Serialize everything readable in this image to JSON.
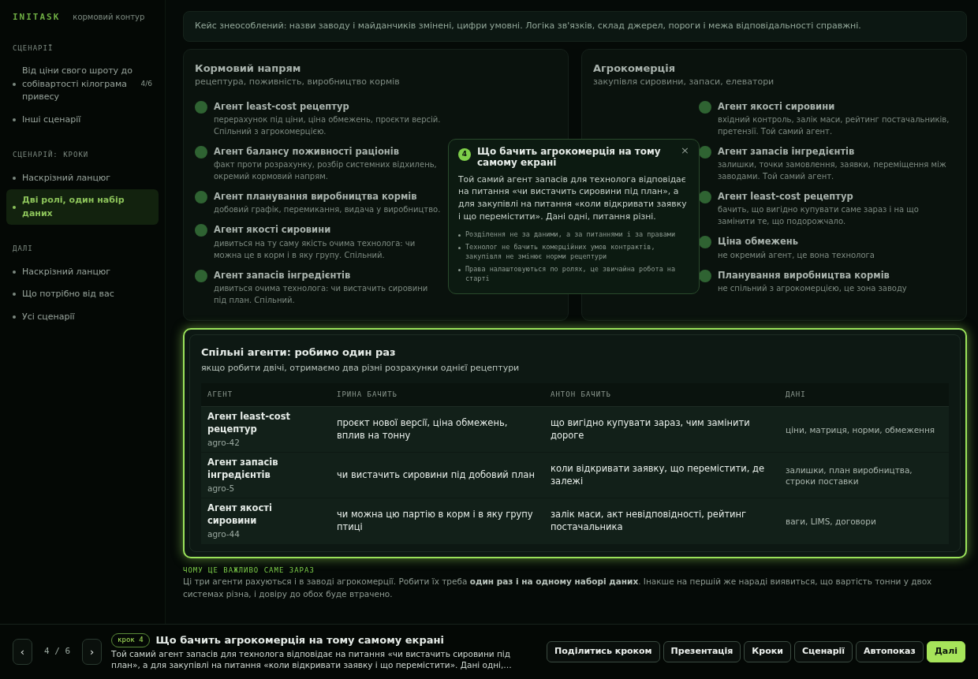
{
  "sidebar": {
    "logo": "INITASK",
    "subtitle": "кормовий контур",
    "sections": [
      {
        "heading": "СЦЕНАРІЇ",
        "items": [
          {
            "label": "Від ціни свого шроту до собівартості кілограма привесу",
            "count": "4/6",
            "selected": false
          },
          {
            "label": "Інші сценарії",
            "selected": false
          }
        ]
      },
      {
        "heading": "СЦЕНАРІЙ: КРОКИ",
        "items": [
          {
            "label": "Наскрізний ланцюг",
            "selected": false
          },
          {
            "label": "Дві ролі, один набір даних",
            "selected": true
          }
        ]
      },
      {
        "heading": "ДАЛІ",
        "items": [
          {
            "label": "Наскрізний ланцюг",
            "selected": false
          },
          {
            "label": "Що потрібно від вас",
            "selected": false
          },
          {
            "label": "Усі сценарії",
            "selected": false
          }
        ]
      }
    ]
  },
  "notice": "Кейс знеособлений: назви заводу і майданчиків змінені, цифри умовні. Логіка зв'язків, склад джерел, пороги і межа відповідальності справжні.",
  "directions": [
    {
      "title": "Кормовий напрям",
      "subtitle": "рецептура, поживність, виробництво кормів",
      "agents": [
        {
          "name": "Агент least-cost рецептур",
          "text": "перерахунок під ціни, ціна обмежень, проєкти версій. Спільний з агрокомерцією."
        },
        {
          "name": "Агент балансу поживності раціонів",
          "text": "факт проти розрахунку, розбір системних відхилень, окремий кормовий напрям."
        },
        {
          "name": "Агент планування виробництва кормів",
          "text": "добовий графік, перемикання, видача у виробництво."
        },
        {
          "name": "Агент якості сировини",
          "text": "дивиться на ту саму якість очима технолога: чи можна це в корм і в яку групу. Спільний."
        },
        {
          "name": "Агент запасів інгредієнтів",
          "text": "дивиться очима технолога: чи вистачить сировини під план. Спільний."
        }
      ]
    },
    {
      "title": "Агрокомерція",
      "subtitle": "закупівля сировини, запаси, елеватори",
      "agents": [
        {
          "name": "Агент якості сировини",
          "text": "вхідний контроль, залік маси, рейтинг постачальників, претензії. Той самий агент."
        },
        {
          "name": "Агент запасів інгредієнтів",
          "text": "залишки, точки замовлення, заявки, переміщення між заводами. Той самий агент."
        },
        {
          "name": "Агент least-cost рецептур",
          "text": "бачить, що вигідно купувати саме зараз і на що замінити те, що подорожчало."
        },
        {
          "name": "Ціна обмежень",
          "text": "не окремий агент, це вона технолога"
        },
        {
          "name": "Планування виробництва кормів",
          "text": "не спільний з агрокомерцією, це зона заводу"
        }
      ]
    }
  ],
  "popover": {
    "step": "4",
    "title": "Що бачить агрокомерція на тому самому екрані",
    "close": "×",
    "body": "Той самий агент запасів для технолога відповідає на питання «чи вистачить сировини під план», а для закупівлі на питання «коли відкривати заявку і що перемістити». Дані одні, питання різні.",
    "bullets": [
      "Розділення не за даними, а за питаннями і за правами",
      "Технолог не бачить комерційних умов контрактів, закупівля не змінює норми рецептури",
      "Права налаштовуються по ролях, це звичайна робота на старті"
    ]
  },
  "shared": {
    "title": "Спільні агенти: робимо один раз",
    "subtitle": "якщо робити двічі, отримаємо два різні розрахунки однієї рецептури",
    "columns": [
      "АГЕНТ",
      "ІРИНА БАЧИТЬ",
      "АНТОН БАЧИТЬ",
      "ДАНІ"
    ],
    "rows": [
      {
        "agent": "Агент least-cost рецептур",
        "code": "agro-42",
        "irina": "проєкт нової версії, ціна обмежень, вплив на тонну",
        "anton": "що вигідно купувати зараз, чим замінити дороге",
        "data": "ціни, матриця, норми, обмеження"
      },
      {
        "agent": "Агент запасів інгредієнтів",
        "code": "agro-5",
        "irina": "чи вистачить сировини під добовий план",
        "anton": "коли відкривати заявку, що перемістити, де залежі",
        "data": "залишки, план виробництва, строки поставки"
      },
      {
        "agent": "Агент якості сировини",
        "code": "agro-44",
        "irina": "чи можна цю партію в корм і в яку групу птиці",
        "anton": "залік маси, акт невідповідності, рейтинг постачальника",
        "data": "ваги, LIMS, договори"
      }
    ]
  },
  "why": {
    "heading": "ЧОМУ ЦЕ ВАЖЛИВО САМЕ ЗАРАЗ",
    "text": "Ці три агенти рахуються і в заводі агрокомерції. Робити їх треба **один раз і на одному наборі даних**. Інакше на першій же нараді виявиться, що вартість тонни у двох системах різна, і довіру до обох буде втрачено."
  },
  "player": {
    "prev": "‹",
    "position": "4 / 6",
    "next": "›",
    "step_badge": "крок 4",
    "title": "Що бачить агрокомерція на тому самому екрані",
    "text": "Той самий агент запасів для технолога відповідає на питання «чи вистачить сировини під план», а для закупівлі на питання «коли відкривати заявку і що перемістити». Дані одні,…",
    "buttons": [
      {
        "label": "Поділитись кроком",
        "kind": "secondary"
      },
      {
        "label": "Презентація",
        "kind": "secondary"
      },
      {
        "label": "Кроки",
        "kind": "secondary"
      },
      {
        "label": "Сценарії",
        "kind": "secondary"
      },
      {
        "label": "Автопоказ",
        "kind": "secondary"
      },
      {
        "label": "Далі",
        "kind": "primary"
      }
    ]
  }
}
